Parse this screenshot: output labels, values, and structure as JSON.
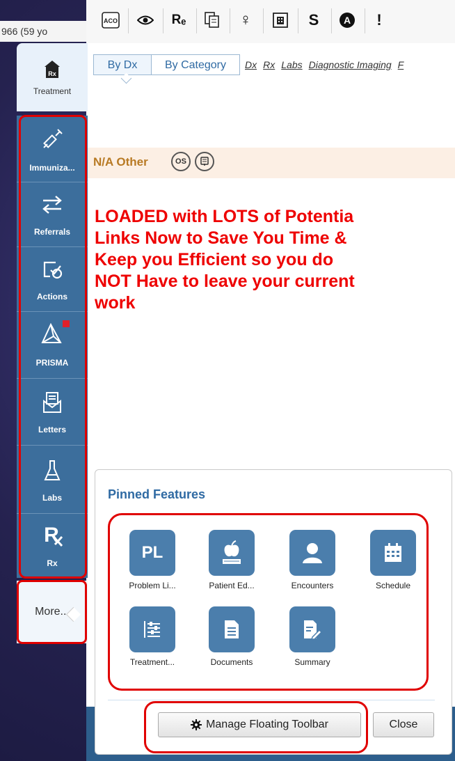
{
  "patient": {
    "age_text": "966 (59 yo"
  },
  "toolbar": {
    "icons": [
      {
        "name": "aco-icon",
        "glyph": "ACO"
      },
      {
        "name": "eye-icon",
        "glyph": "◉"
      },
      {
        "name": "re-icon",
        "glyph": "Rₑ"
      },
      {
        "name": "copy-icon",
        "glyph": "⧉"
      },
      {
        "name": "female-icon",
        "glyph": "♀"
      },
      {
        "name": "building-icon",
        "glyph": "▦"
      },
      {
        "name": "s-icon",
        "glyph": "S"
      },
      {
        "name": "a-circle-icon",
        "glyph": "A"
      },
      {
        "name": "more-toolbar-icon",
        "glyph": "!"
      }
    ]
  },
  "tabs": {
    "by_dx": "By Dx",
    "by_category": "By Category",
    "links": [
      "Dx",
      "Rx",
      "Labs",
      "Diagnostic Imaging",
      "F"
    ]
  },
  "na_row": {
    "label": "N/A Other",
    "os_badge": "OS"
  },
  "promo_lines": [
    "LOADED with LOTS of Potentia",
    "Links Now to Save You Time &",
    "Keep you Efficient so you do",
    "NOT Have to leave your current",
    "work"
  ],
  "sidebar": {
    "treatment": "Treatment",
    "items": [
      {
        "label": "Immuniza...",
        "icon": "syringe-icon"
      },
      {
        "label": "Referrals",
        "icon": "swap-arrows-icon"
      },
      {
        "label": "Actions",
        "icon": "checklist-icon"
      },
      {
        "label": "PRISMA",
        "icon": "prism-icon"
      },
      {
        "label": "Letters",
        "icon": "envelope-icon"
      },
      {
        "label": "Labs",
        "icon": "flask-icon"
      },
      {
        "label": "Rx",
        "icon": "rx-icon"
      }
    ],
    "more": "More..."
  },
  "popup": {
    "title": "Pinned Features",
    "features": [
      {
        "label": "Problem Li...",
        "icon": "pl-icon",
        "glyph": "PL"
      },
      {
        "label": "Patient Ed...",
        "icon": "apple-book-icon"
      },
      {
        "label": "Encounters",
        "icon": "person-icon"
      },
      {
        "label": "Schedule",
        "icon": "calendar-icon"
      },
      {
        "label": "Treatment...",
        "icon": "sliders-icon"
      },
      {
        "label": "Documents",
        "icon": "document-icon"
      },
      {
        "label": "Summary",
        "icon": "summary-doc-icon"
      }
    ],
    "manage_button": "Manage Floating Toolbar",
    "close_button": "Close"
  },
  "colors": {
    "sidebar_blue": "#3c6e9c",
    "tile_blue": "#4b7eac",
    "promo_red": "#ee0000",
    "highlight_red": "#e00000",
    "link_blue": "#2f6aa3"
  }
}
